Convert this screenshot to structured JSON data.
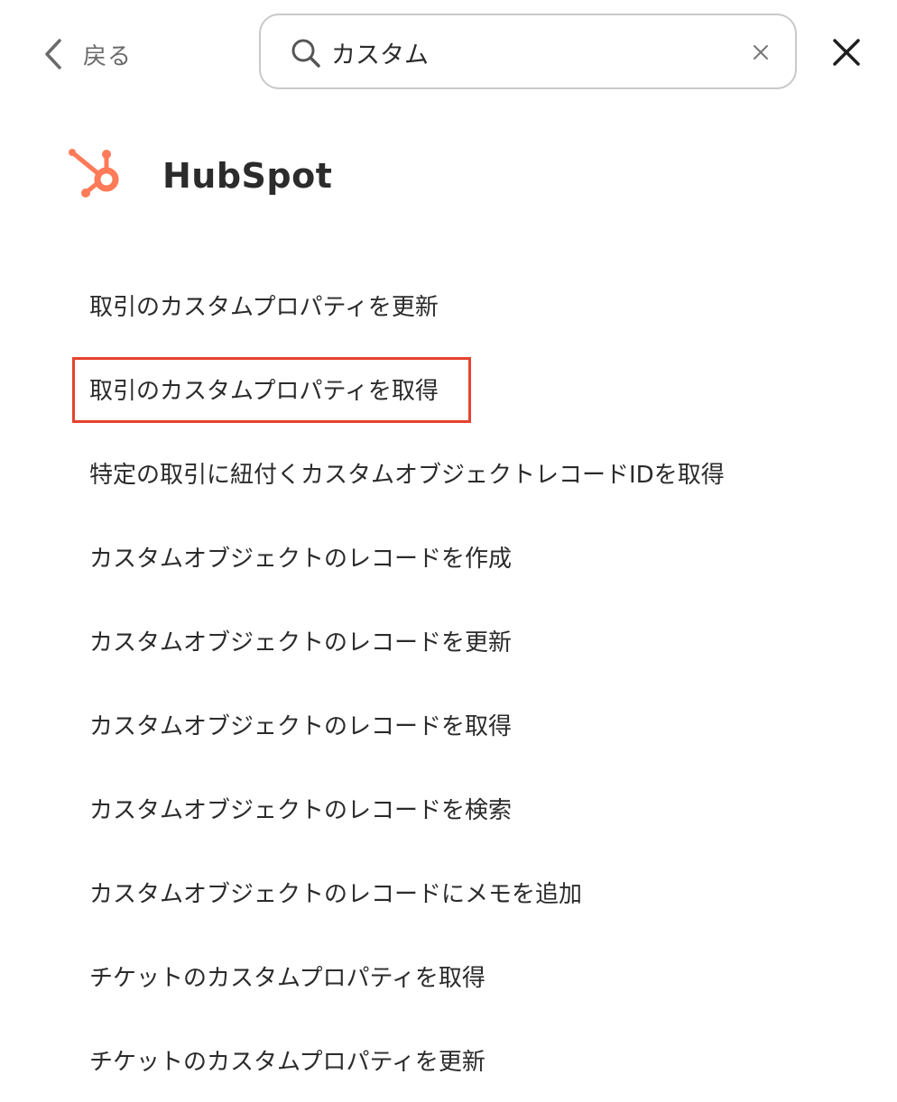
{
  "header": {
    "back_label": "戻る",
    "search": {
      "value": "カスタム",
      "placeholder": ""
    }
  },
  "icons": {
    "back": "chevron-left-icon",
    "search": "search-icon",
    "clear": "clear-icon",
    "close": "close-icon",
    "app_logo": "hubspot-logo-icon"
  },
  "app": {
    "name": "HubSpot",
    "brand_color": "#ff7a59"
  },
  "highlight_color": "#e5432e",
  "results": [
    {
      "label": "取引のカスタムプロパティを更新"
    },
    {
      "label": "取引のカスタムプロパティを取得",
      "highlighted": true
    },
    {
      "label": "特定の取引に紐付くカスタムオブジェクトレコードIDを取得"
    },
    {
      "label": "カスタムオブジェクトのレコードを作成"
    },
    {
      "label": "カスタムオブジェクトのレコードを更新"
    },
    {
      "label": "カスタムオブジェクトのレコードを取得"
    },
    {
      "label": "カスタムオブジェクトのレコードを検索"
    },
    {
      "label": "カスタムオブジェクトのレコードにメモを追加"
    },
    {
      "label": "チケットのカスタムプロパティを取得"
    },
    {
      "label": "チケットのカスタムプロパティを更新"
    }
  ]
}
